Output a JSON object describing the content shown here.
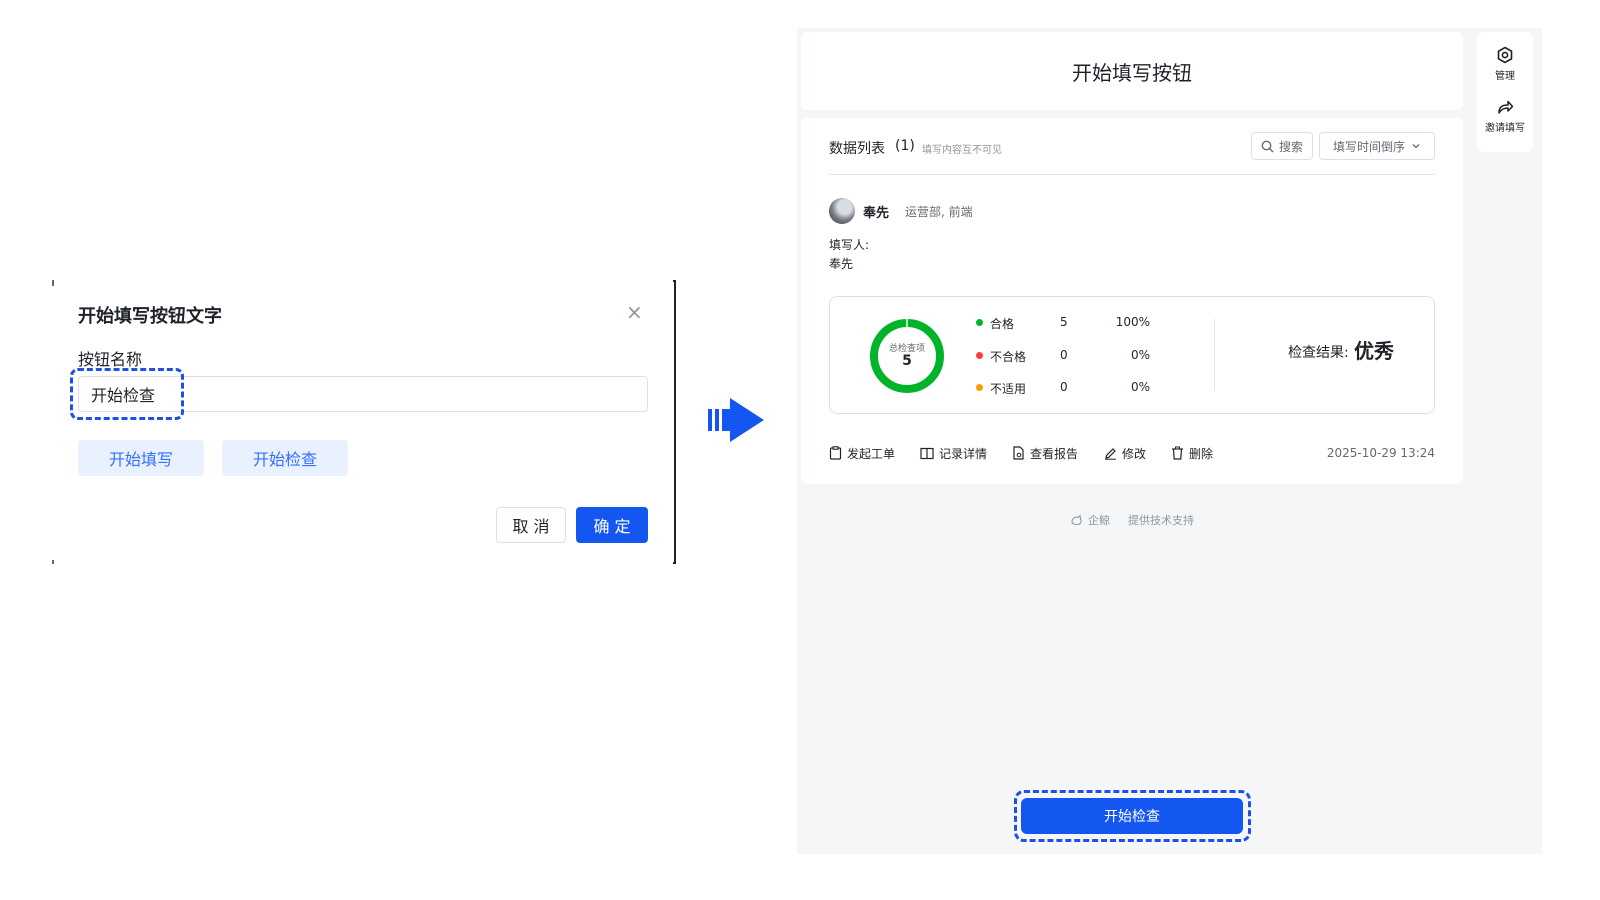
{
  "dialog": {
    "title": "开始填写按钮文字",
    "field_label": "按钮名称",
    "input_value": "开始检查",
    "presets": [
      "开始填写",
      "开始检查"
    ],
    "cancel_label": "取 消",
    "ok_label": "确 定"
  },
  "form_page": {
    "title": "开始填写按钮",
    "tools": {
      "manage": "管理",
      "invite": "邀请填写"
    },
    "list": {
      "title": "数据列表",
      "count": "(1)",
      "subtitle": "填写内容互不可见",
      "search_label": "搜索",
      "sort_label": "填写时间倒序"
    },
    "record": {
      "user_name": "奉先",
      "department": "运营部, 前端",
      "filler_label": "填写人:",
      "filler_value": "奉先",
      "summary": {
        "donut_label": "总检查项",
        "donut_total": "5",
        "items": [
          {
            "name": "合格",
            "count": "5",
            "percent": "100%",
            "color": "#00b42a"
          },
          {
            "name": "不合格",
            "count": "0",
            "percent": "0%",
            "color": "#f53f3f"
          },
          {
            "name": "不适用",
            "count": "0",
            "percent": "0%",
            "color": "#ff9a00"
          }
        ],
        "verdict_label": "检查结果:",
        "verdict_value": "优秀"
      },
      "actions": [
        "发起工单",
        "记录详情",
        "查看报告",
        "修改",
        "删除"
      ],
      "timestamp": "2025-10-29 13:24"
    },
    "powered_by": {
      "brand": "企鲸",
      "text": "提供技术支持"
    },
    "start_button_label": "开始检查"
  },
  "colors": {
    "primary": "#1456f0",
    "highlight_dash": "#1e50e6",
    "chip_bg": "#e9f0ff",
    "chip_text": "#3370ff",
    "pass_ring": "#00b42a"
  }
}
